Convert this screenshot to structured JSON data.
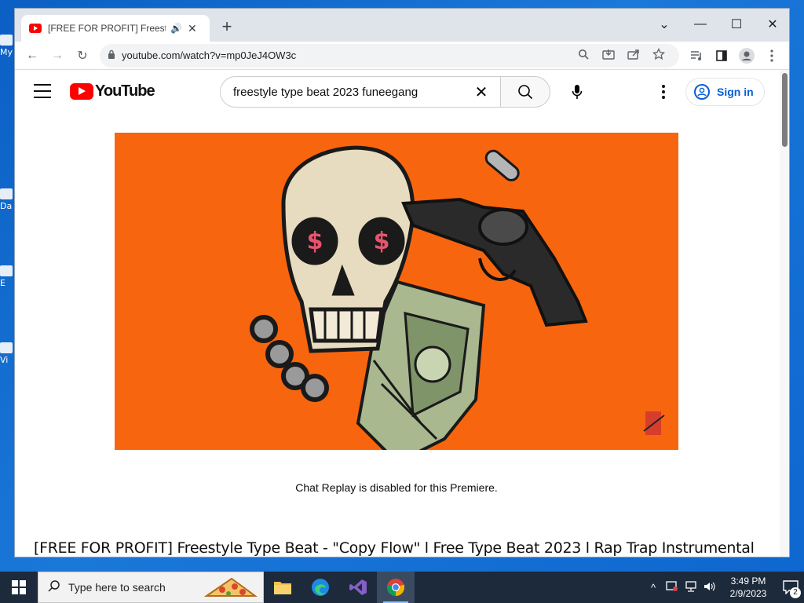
{
  "desktop": {
    "icons": [
      {
        "label": "My"
      },
      {
        "label": "Da"
      },
      {
        "label": "E"
      },
      {
        "label": "Vi"
      }
    ]
  },
  "browser": {
    "tab": {
      "title": "[FREE FOR PROFIT] Freestyle",
      "close": "✕",
      "audio": "🔊"
    },
    "new_tab": "+",
    "window_controls": {
      "dropdown": "⌄",
      "minimize": "—",
      "maximize": "☐",
      "close": "✕"
    },
    "toolbar": {
      "back": "←",
      "forward": "→",
      "reload": "↻",
      "url": "youtube.com/watch?v=mp0JeJ4OW3c",
      "lock": "🔒"
    }
  },
  "youtube": {
    "logo_text": "YouTube",
    "search": {
      "query": "freestyle type beat 2023 funeegang",
      "clear": "✕"
    },
    "sign_in": "Sign in",
    "chat_note": "Chat Replay is disabled for this Premiere.",
    "video_title": "[FREE FOR PROFIT] Freestyle Type Beat - \"Copy Flow\" l Free Type Beat 2023 l Rap Trap Instrumental",
    "thumbnail": {
      "background": "#f8650f",
      "eye_symbol": "$"
    }
  },
  "taskbar": {
    "search_placeholder": "Type here to search",
    "time": "3:49 PM",
    "date": "2/9/2023",
    "notification_count": "2"
  }
}
